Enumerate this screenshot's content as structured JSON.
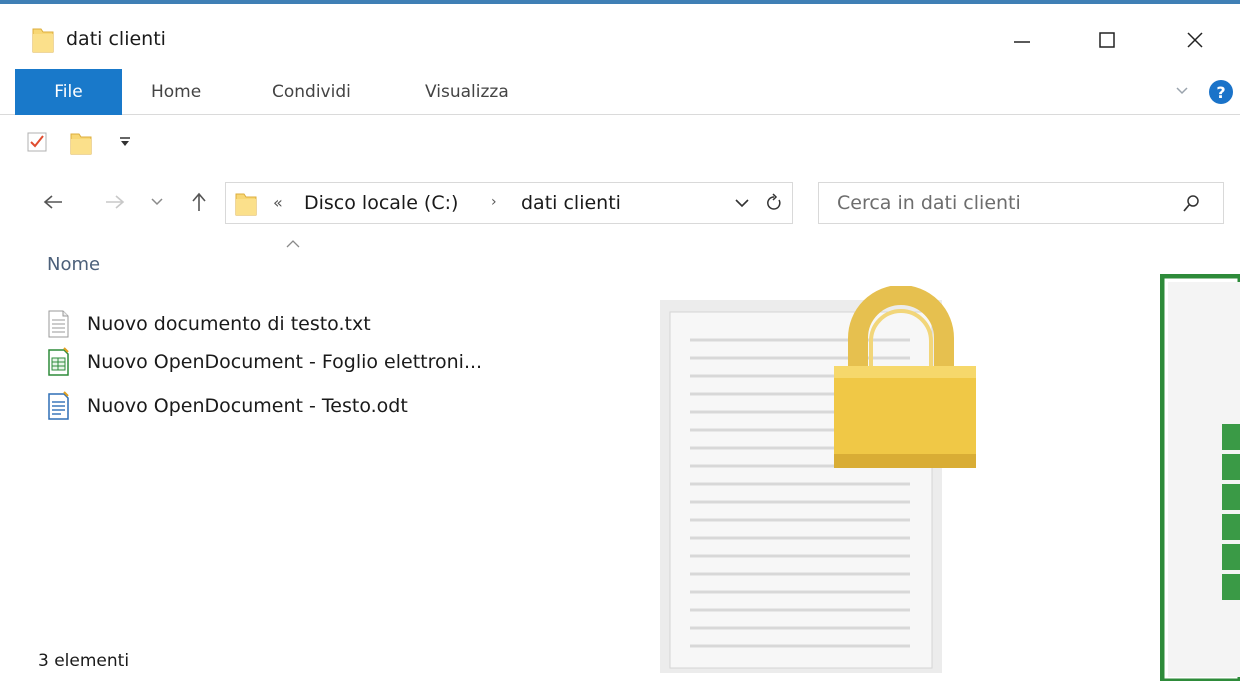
{
  "window": {
    "title": "dati clienti",
    "accent": "#1979ca"
  },
  "ribbon": {
    "tabs": [
      {
        "label": "File"
      },
      {
        "label": "Home"
      },
      {
        "label": "Condividi"
      },
      {
        "label": "Visualizza"
      }
    ],
    "help": "?"
  },
  "address": {
    "overflow": "«",
    "crumbs": [
      "Disco locale (C:)",
      "dati clienti"
    ],
    "separator": "›"
  },
  "search": {
    "placeholder": "Cerca in dati clienti"
  },
  "columns": {
    "name": "Nome"
  },
  "files": [
    {
      "name": "Nuovo documento di testo.txt",
      "icon": "text-file-icon"
    },
    {
      "name": "Nuovo OpenDocument - Foglio elettroni...",
      "icon": "spreadsheet-file-icon"
    },
    {
      "name": "Nuovo OpenDocument - Testo.odt",
      "icon": "writer-file-icon"
    }
  ],
  "status": {
    "count": "3 elementi"
  }
}
